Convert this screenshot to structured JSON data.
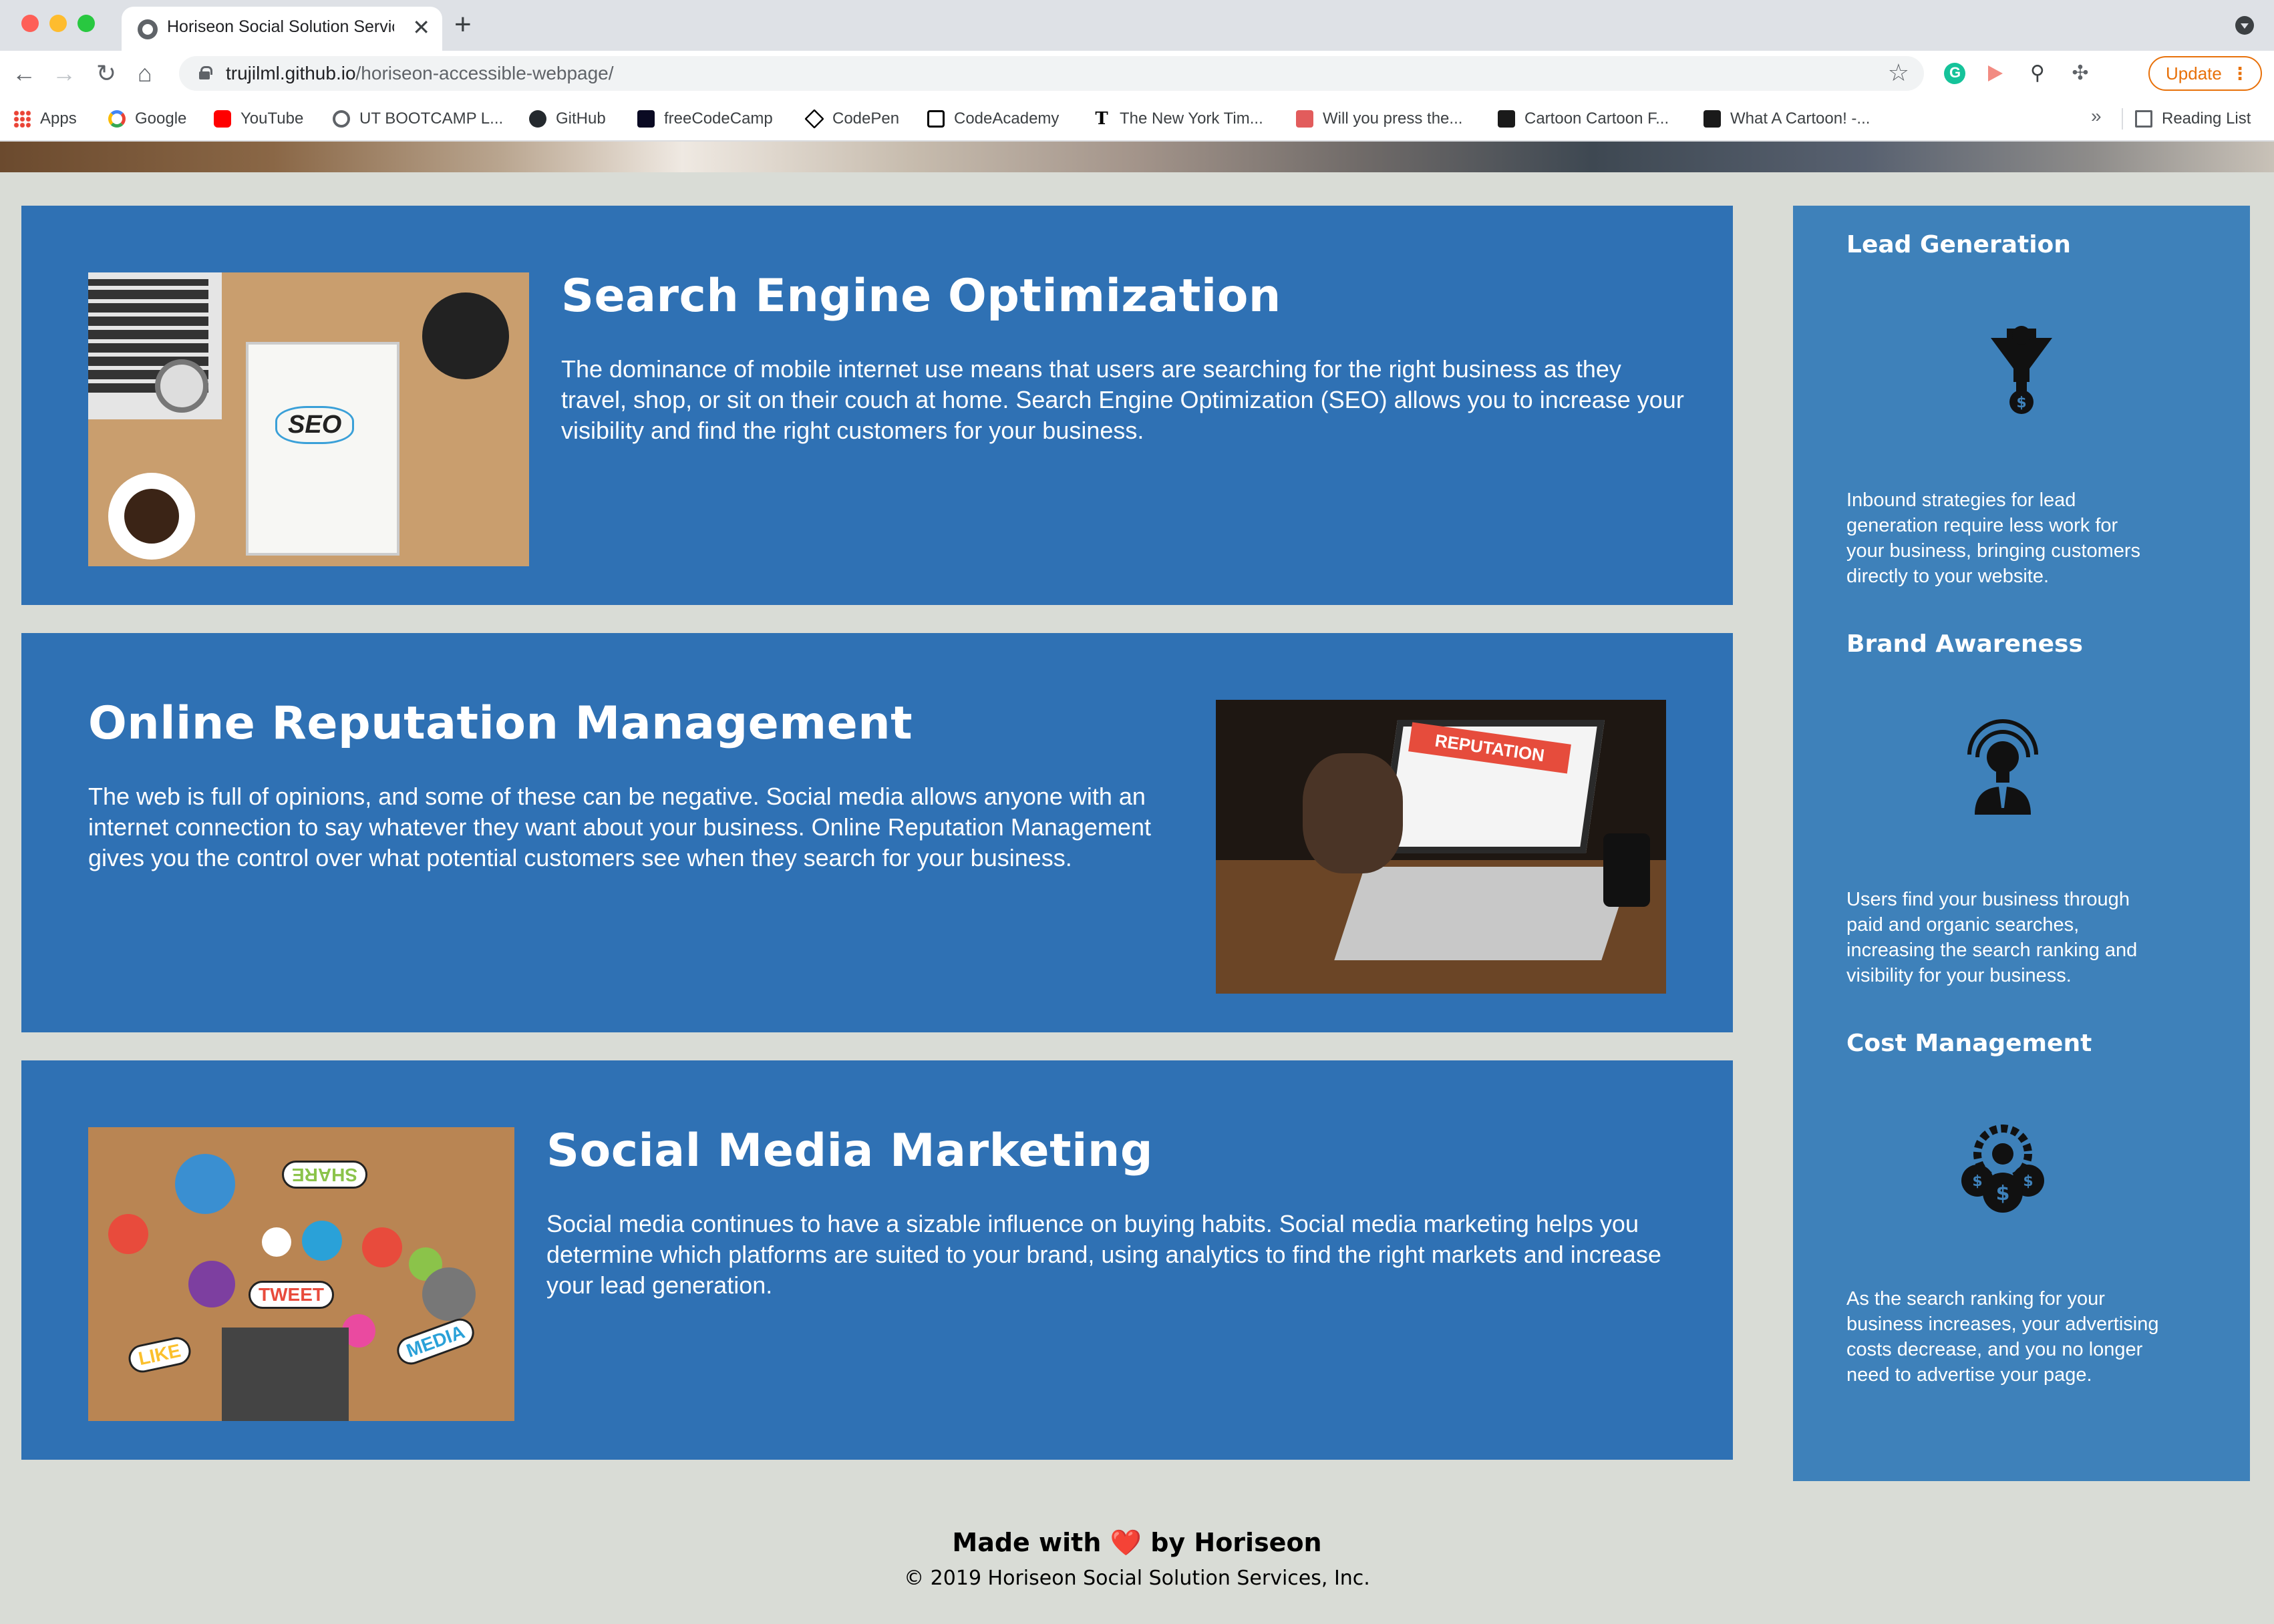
{
  "browser": {
    "tab_title": "Horiseon Social Solution Services",
    "close_glyph": "✕",
    "new_tab_glyph": "+",
    "url_host": "trujilml.github.io",
    "url_path": "/horiseon-accessible-webpage/",
    "update_label": "Update",
    "update_menu_glyph": "⋮",
    "bookmarks": [
      {
        "label": "Apps",
        "icon": "apps-grid-icon"
      },
      {
        "label": "Google",
        "icon": "google-icon"
      },
      {
        "label": "YouTube",
        "icon": "youtube-icon"
      },
      {
        "label": "UT BOOTCAMP L...",
        "icon": "globe-icon"
      },
      {
        "label": "GitHub",
        "icon": "github-icon"
      },
      {
        "label": "freeCodeCamp",
        "icon": "freecodecamp-icon"
      },
      {
        "label": "CodePen",
        "icon": "codepen-icon"
      },
      {
        "label": "CodeAcademy",
        "icon": "codecademy-icon"
      },
      {
        "label": "The New York Tim...",
        "icon": "nyt-icon"
      },
      {
        "label": "Will you press the...",
        "icon": "press-button-icon"
      },
      {
        "label": "Cartoon Cartoon F...",
        "icon": "cartoon-icon"
      },
      {
        "label": "What A Cartoon! -...",
        "icon": "cartoon-icon"
      }
    ],
    "bookmarks_more": "»",
    "reading_list": "Reading List"
  },
  "articles": [
    {
      "title": "Search Engine Optimization",
      "text": "The dominance of mobile internet use means that users are searching for the right business as they travel, shop, or sit on their couch at home. Search Engine Optimization (SEO) allows you to increase your visibility and find the right customers for your business.",
      "image": {
        "seo_word": "SEO"
      }
    },
    {
      "title": "Online Reputation Management",
      "text": "The web is full of opinions, and some of these can be negative. Social media allows anyone with an internet connection to say whatever they want about your business. Online Reputation Management gives you the control over what potential customers see when they search for your business.",
      "image": {
        "banner": "REPUTATION"
      }
    },
    {
      "title": "Social Media Marketing",
      "text": "Social media continues to have a sizable influence on buying habits. Social media marketing helps you determine which platforms are suited to your brand, using analytics to find the right markets and increase your lead generation.",
      "image": {
        "share": "SHARE",
        "tweet": "TWEET",
        "like": "LIKE",
        "media": "MEDIA"
      }
    }
  ],
  "benefits": [
    {
      "title": "Lead Generation",
      "icon": "lead-funnel-icon",
      "text": "Inbound strategies for lead generation require less work for your business, bringing customers directly to your website."
    },
    {
      "title": "Brand Awareness",
      "icon": "lightbulb-person-icon",
      "text": "Users find your business through paid and organic searches, increasing the search ranking and visibility for your business."
    },
    {
      "title": "Cost Management",
      "icon": "money-gear-icon",
      "text": "As the search ranking for your business increases, your advertising costs decrease, and you no longer need to advertise your page."
    }
  ],
  "footer": {
    "made_prefix": "Made with",
    "heart": "❤️",
    "made_suffix": "by Horiseon",
    "copyright": "© 2019 Horiseon Social Solution Services, Inc."
  },
  "colors": {
    "page_bg": "#d9dcd6",
    "article_bg": "#2f71b4",
    "aside_bg": "#3e81ba",
    "text": "#ffffff"
  }
}
